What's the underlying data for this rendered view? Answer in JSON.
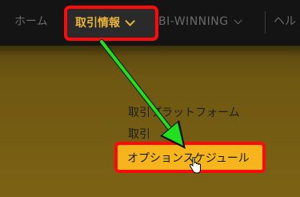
{
  "nav": {
    "home_label": "ホーム",
    "trade_info_label": "取引情報",
    "bi_winning_label": "BI-WINNING",
    "help_label": "ヘル"
  },
  "dropdown": {
    "items": [
      {
        "label": "取引プラットフォーム"
      },
      {
        "label": "取引"
      },
      {
        "label": "オプションスケジュール"
      }
    ]
  },
  "colors": {
    "accent": "#e7b43a",
    "highlight_border": "#ff0a0a",
    "highlight_fill": "#f6b51c",
    "arrow": "#22e01d"
  },
  "icons": {
    "chevron": "chevron-down-icon",
    "cursor": "hand-cursor-icon"
  }
}
